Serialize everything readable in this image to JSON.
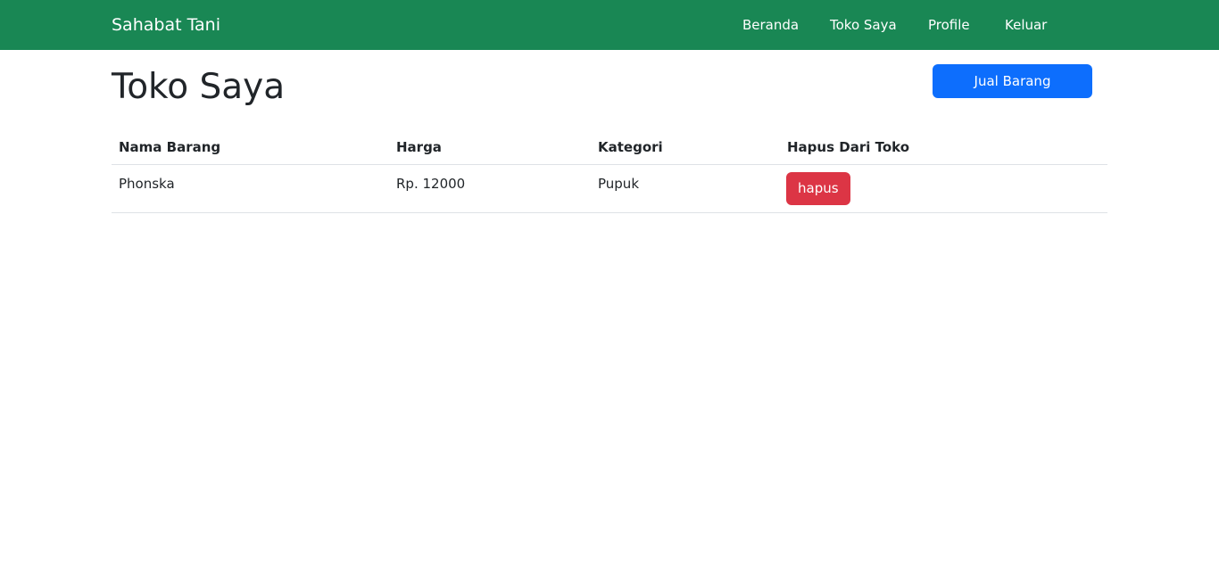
{
  "navbar": {
    "brand": "Sahabat Tani",
    "links": [
      {
        "label": "Beranda"
      },
      {
        "label": "Toko Saya"
      },
      {
        "label": "Profile"
      },
      {
        "label": "Keluar"
      }
    ],
    "background_color": "#198754"
  },
  "page": {
    "title": "Toko Saya",
    "sell_button_label": "Jual Barang",
    "sell_button_color": "#0d6efd"
  },
  "table": {
    "headers": [
      "Nama Barang",
      "Harga",
      "Kategori",
      "Hapus Dari Toko"
    ],
    "rows": [
      {
        "name": "Phonska",
        "price": "Rp. 12000",
        "category": "Pupuk",
        "delete_label": "hapus"
      }
    ],
    "delete_button_color": "#dc3545"
  }
}
